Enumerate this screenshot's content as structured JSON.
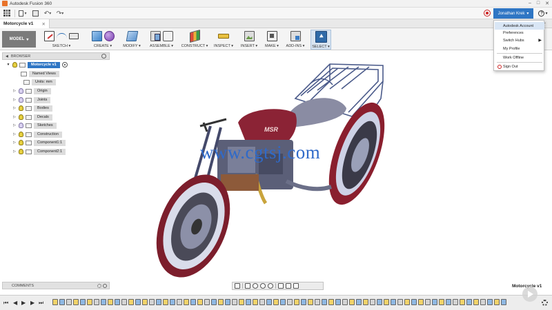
{
  "window": {
    "title": "Autodesk Fusion 360",
    "minimize": "–",
    "maximize": "□",
    "close": "✕"
  },
  "quick_access": {
    "file_icon": "document-icon",
    "save_icon": "save-icon",
    "undo": "↶",
    "redo": "↷",
    "dropdown": "▾"
  },
  "account": {
    "user_name": "Jonathan Krek",
    "caret": "▾",
    "help": "?",
    "help_caret": "▾"
  },
  "tabs": {
    "active_doc": "Motorcycle v1",
    "close": "✕",
    "new_tab": "+"
  },
  "ribbon": {
    "workspace": "MODEL",
    "workspace_caret": "▾",
    "groups": [
      {
        "id": "sketch",
        "label": "SKETCH ▾"
      },
      {
        "id": "create",
        "label": "CREATE ▾"
      },
      {
        "id": "modify",
        "label": "MODIFY ▾"
      },
      {
        "id": "assemble",
        "label": "ASSEMBLE ▾"
      },
      {
        "id": "construct",
        "label": "CONSTRUCT ▾"
      },
      {
        "id": "inspect",
        "label": "INSPECT ▾"
      },
      {
        "id": "insert",
        "label": "INSERT ▾"
      },
      {
        "id": "make",
        "label": "MAKE ▾"
      },
      {
        "id": "addins",
        "label": "ADD-INS ▾"
      },
      {
        "id": "select",
        "label": "SELECT ▾"
      }
    ]
  },
  "browser": {
    "title": "BROWSER",
    "collapse": "◀",
    "root": "Motorcycle v1",
    "items": [
      {
        "label": "Named Views"
      },
      {
        "label": "Units: mm"
      },
      {
        "label": "Origin"
      },
      {
        "label": "Joints"
      },
      {
        "label": "Bodies"
      },
      {
        "label": "Decals"
      },
      {
        "label": "Sketches"
      },
      {
        "label": "Construction"
      },
      {
        "label": "Component1:1"
      },
      {
        "label": "Component2:1"
      }
    ]
  },
  "account_menu": {
    "items": [
      {
        "label": "Autodesk Account"
      },
      {
        "label": "Preferences"
      },
      {
        "label": "Switch Hubs",
        "arrow": "▶"
      },
      {
        "label": "My Profile"
      },
      {
        "label": "Work Offline"
      },
      {
        "label": "Sign Out"
      }
    ]
  },
  "viewport": {
    "watermark": "www.cgtsj.com",
    "doc_name": "Motorcycle v1"
  },
  "comments": {
    "title": "COMMENTS"
  },
  "timeline": {
    "controls": [
      "⏮",
      "◀",
      "▶",
      "▶",
      "⏭"
    ]
  }
}
